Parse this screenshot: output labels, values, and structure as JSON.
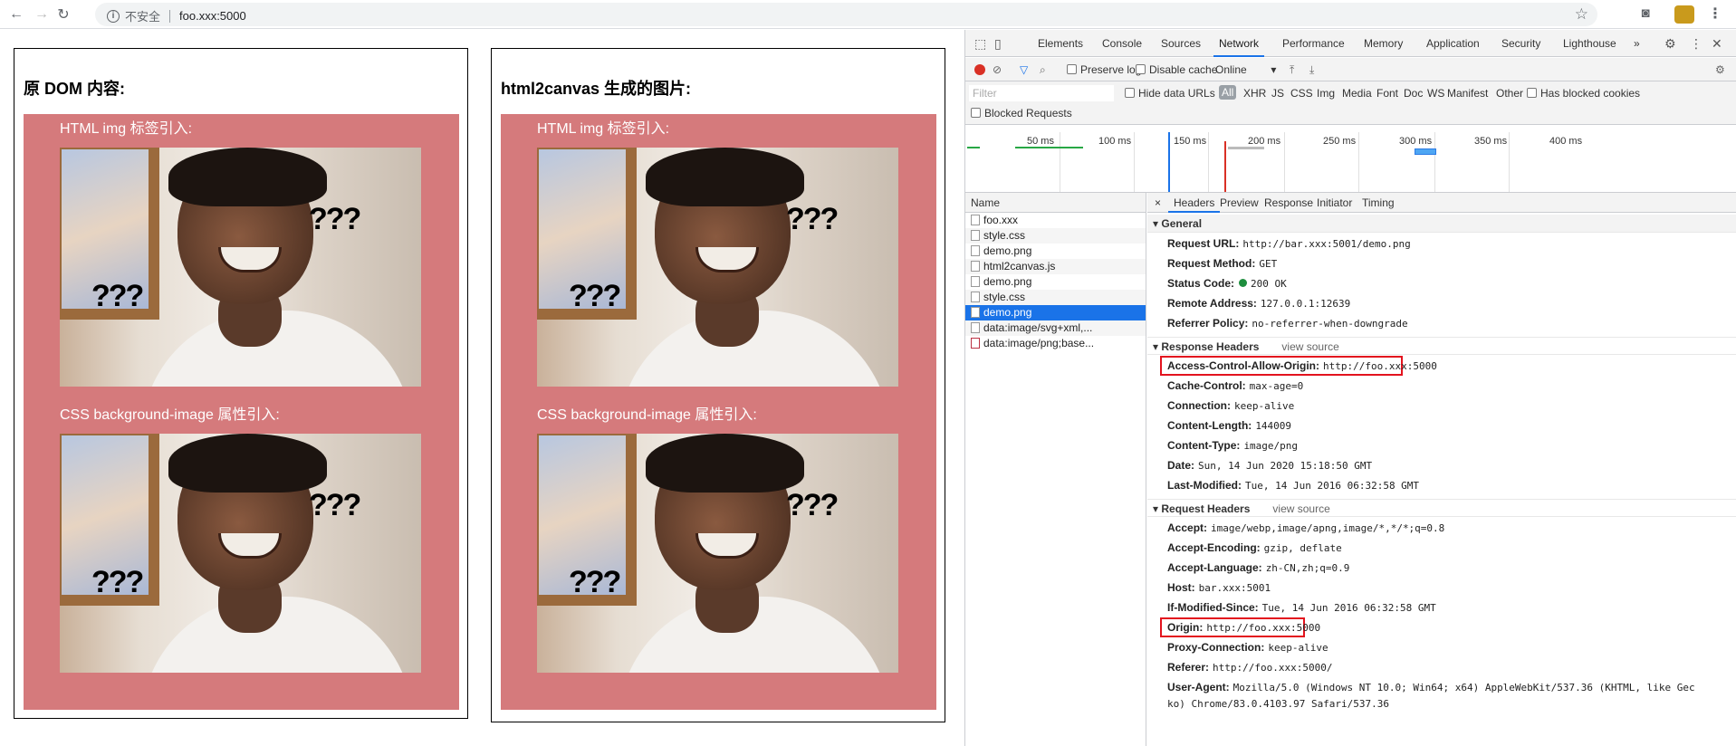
{
  "browser": {
    "security_label": "不安全",
    "url": "foo.xxx:5000"
  },
  "page": {
    "left_title": "原 DOM 内容:",
    "right_title": "html2canvas 生成的图片:",
    "img_label": "HTML img 标签引入:",
    "css_label": "CSS background-image 属性引入:",
    "photo_text": "???"
  },
  "devtools": {
    "tabs": [
      "Elements",
      "Console",
      "Sources",
      "Network",
      "Performance",
      "Memory",
      "Application",
      "Security",
      "Lighthouse"
    ],
    "more": "»",
    "toolbar": {
      "preserve_log": "Preserve log",
      "disable_cache": "Disable cache",
      "throttle": "Online"
    },
    "filter": {
      "placeholder": "Filter",
      "hide_data_urls": "Hide data URLs",
      "types": [
        "All",
        "XHR",
        "JS",
        "CSS",
        "Img",
        "Media",
        "Font",
        "Doc",
        "WS",
        "Manifest",
        "Other"
      ],
      "has_blocked": "Has blocked cookies",
      "blocked_requests": "Blocked Requests"
    },
    "timeline_ticks": [
      "50 ms",
      "100 ms",
      "150 ms",
      "200 ms",
      "250 ms",
      "300 ms",
      "350 ms",
      "400 ms"
    ],
    "name_header": "Name",
    "requests": [
      "foo.xxx",
      "style.css",
      "demo.png",
      "html2canvas.js",
      "demo.png",
      "style.css",
      "demo.png",
      "data:image/svg+xml,...",
      "data:image/png;base..."
    ],
    "detail_tabs": [
      "Headers",
      "Preview",
      "Response",
      "Initiator",
      "Timing"
    ],
    "close": "×",
    "general_title": "General",
    "general": [
      {
        "k": "Request URL:",
        "v": "http://bar.xxx:5001/demo.png"
      },
      {
        "k": "Request Method:",
        "v": "GET"
      },
      {
        "k": "Status Code:",
        "v": "200 OK"
      },
      {
        "k": "Remote Address:",
        "v": "127.0.0.1:12639"
      },
      {
        "k": "Referrer Policy:",
        "v": "no-referrer-when-downgrade"
      }
    ],
    "response_title": "Response Headers",
    "view_source": "view source",
    "response": [
      {
        "k": "Access-Control-Allow-Origin:",
        "v": "http://foo.xxx:5000"
      },
      {
        "k": "Cache-Control:",
        "v": "max-age=0"
      },
      {
        "k": "Connection:",
        "v": "keep-alive"
      },
      {
        "k": "Content-Length:",
        "v": "144009"
      },
      {
        "k": "Content-Type:",
        "v": "image/png"
      },
      {
        "k": "Date:",
        "v": "Sun, 14 Jun 2020 15:18:50 GMT"
      },
      {
        "k": "Last-Modified:",
        "v": "Tue, 14 Jun 2016 06:32:58 GMT"
      }
    ],
    "request_title": "Request Headers",
    "request": [
      {
        "k": "Accept:",
        "v": "image/webp,image/apng,image/*,*/*;q=0.8"
      },
      {
        "k": "Accept-Encoding:",
        "v": "gzip, deflate"
      },
      {
        "k": "Accept-Language:",
        "v": "zh-CN,zh;q=0.9"
      },
      {
        "k": "Host:",
        "v": "bar.xxx:5001"
      },
      {
        "k": "If-Modified-Since:",
        "v": "Tue, 14 Jun 2016 06:32:58 GMT"
      },
      {
        "k": "Origin:",
        "v": "http://foo.xxx:5000"
      },
      {
        "k": "Proxy-Connection:",
        "v": "keep-alive"
      },
      {
        "k": "Referer:",
        "v": "http://foo.xxx:5000/"
      },
      {
        "k": "User-Agent:",
        "v": "Mozilla/5.0 (Windows NT 10.0; Win64; x64) AppleWebKit/537.36 (KHTML, like Gec"
      },
      {
        "k": "",
        "v": "ko) Chrome/83.0.4103.97 Safari/537.36"
      }
    ]
  }
}
